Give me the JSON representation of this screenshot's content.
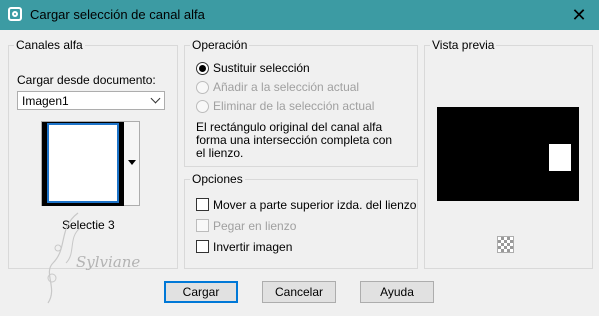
{
  "window": {
    "title": "Cargar selección de canal alfa",
    "close_glyph": "✕",
    "icon": "app-icon"
  },
  "canales": {
    "group_title": "Canales alfa",
    "load_from_label": "Cargar desde documento:",
    "document": "Imagen1",
    "thumbnail_label": "Selectie 3"
  },
  "operacion": {
    "group_title": "Operación",
    "options": [
      {
        "label": "Sustituir selección",
        "checked": true,
        "enabled": true
      },
      {
        "label": "Añadir a la selección actual",
        "checked": false,
        "enabled": false
      },
      {
        "label": "Eliminar de la selección actual",
        "checked": false,
        "enabled": false
      }
    ],
    "description_line1": "El rectángulo original del canal alfa",
    "description_line2": "forma una intersección completa con",
    "description_line3": "el lienzo."
  },
  "opciones": {
    "group_title": "Opciones",
    "items": [
      {
        "label": "Mover a parte superior izda. del lienzo",
        "checked": false,
        "enabled": true
      },
      {
        "label": "Pegar en lienzo",
        "checked": false,
        "enabled": false
      },
      {
        "label": "Invertir imagen",
        "checked": false,
        "enabled": true
      }
    ]
  },
  "preview": {
    "group_title": "Vista previa"
  },
  "buttons": {
    "load": "Cargar",
    "cancel": "Cancelar",
    "help": "Ayuda"
  },
  "watermark": "Sylviane",
  "colors": {
    "titlebar": "#3c9ba3",
    "accent": "#0078d7",
    "background": "#f0f0f0"
  }
}
